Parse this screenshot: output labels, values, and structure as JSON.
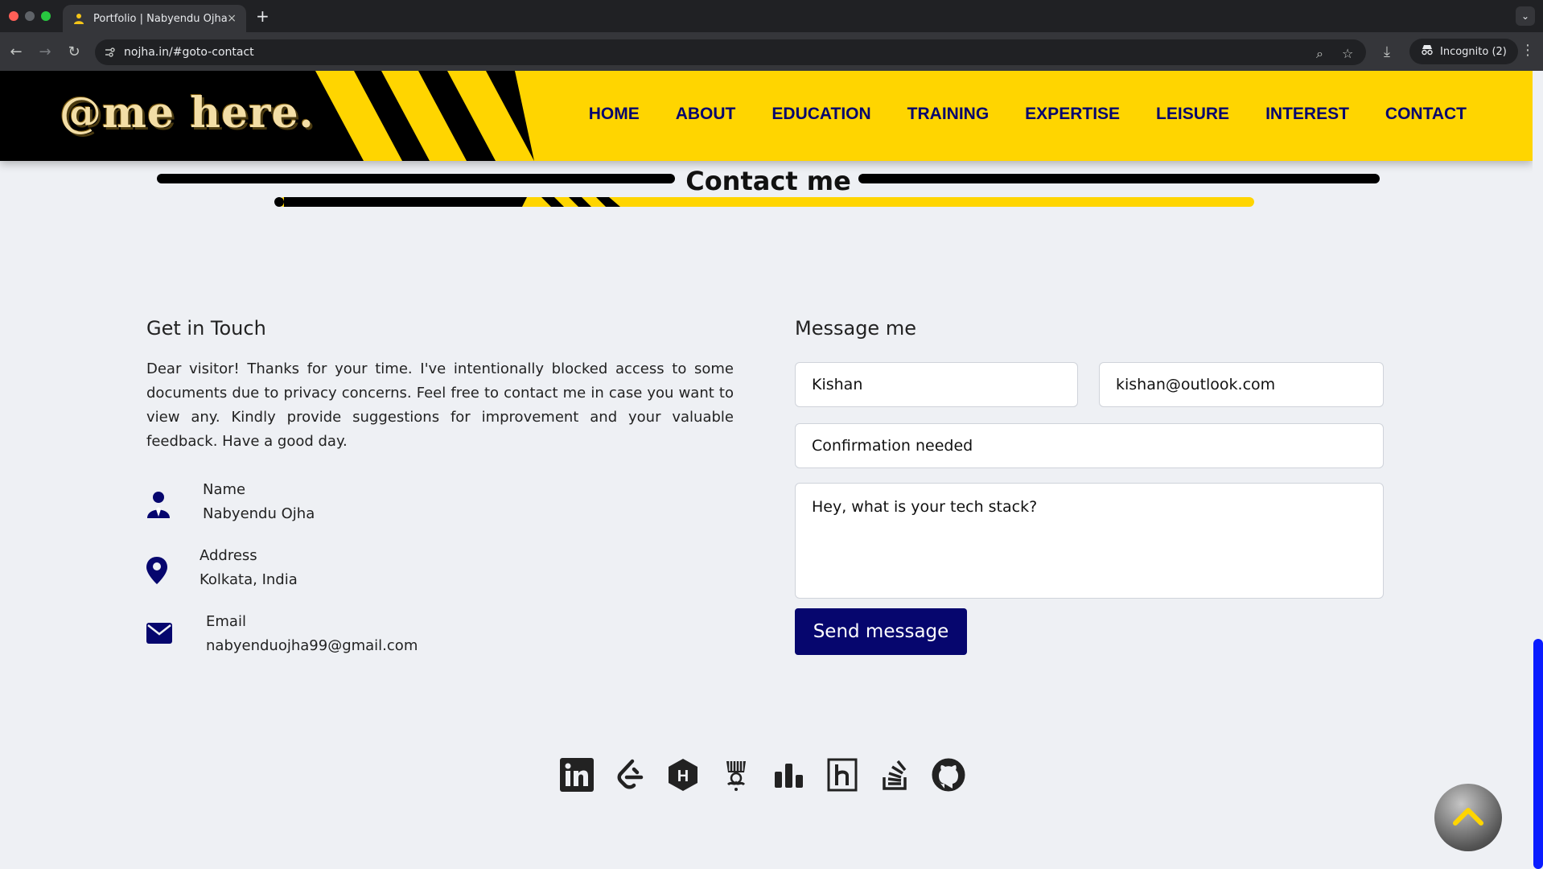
{
  "browser": {
    "tab_title": "Portfolio | Nabyendu Ojha",
    "tab_close": "×",
    "new_tab": "+",
    "url": "nojha.in/#goto-contact",
    "incognito_label": "Incognito (2)"
  },
  "site": {
    "logo": "@me here.",
    "nav": [
      "HOME",
      "ABOUT",
      "EDUCATION",
      "TRAINING",
      "EXPERTISE",
      "LEISURE",
      "INTEREST",
      "CONTACT"
    ],
    "section_title": "Contact me"
  },
  "contact": {
    "heading": "Get in Touch",
    "message": "Dear visitor! Thanks for your time. I've intentionally blocked access to some documents due to privacy concerns. Feel free to contact me in case you want to view any. Kindly provide suggestions for improvement and your valuable feedback. Have a good day.",
    "name_label": "Name",
    "name_value": "Nabyendu Ojha",
    "address_label": "Address",
    "address_value": "Kolkata, India",
    "email_label": "Email",
    "email_value": "nabyenduojha99@gmail.com"
  },
  "form": {
    "heading": "Message me",
    "name_value": "Kishan",
    "email_value": "kishan@outlook.com",
    "subject_value": "Confirmation needed",
    "message_value": "Hey, what is your tech stack?",
    "send_label": "Send message"
  },
  "socials": [
    "linkedin-icon",
    "leetcode-icon",
    "hackerearth-icon",
    "codechef-icon",
    "codeforces-icon",
    "hackerrank-icon",
    "stackoverflow-icon",
    "github-icon"
  ],
  "colors": {
    "brand_yellow": "#ffd500",
    "navy": "#06066e",
    "scrollbar": "#0a1cff"
  }
}
